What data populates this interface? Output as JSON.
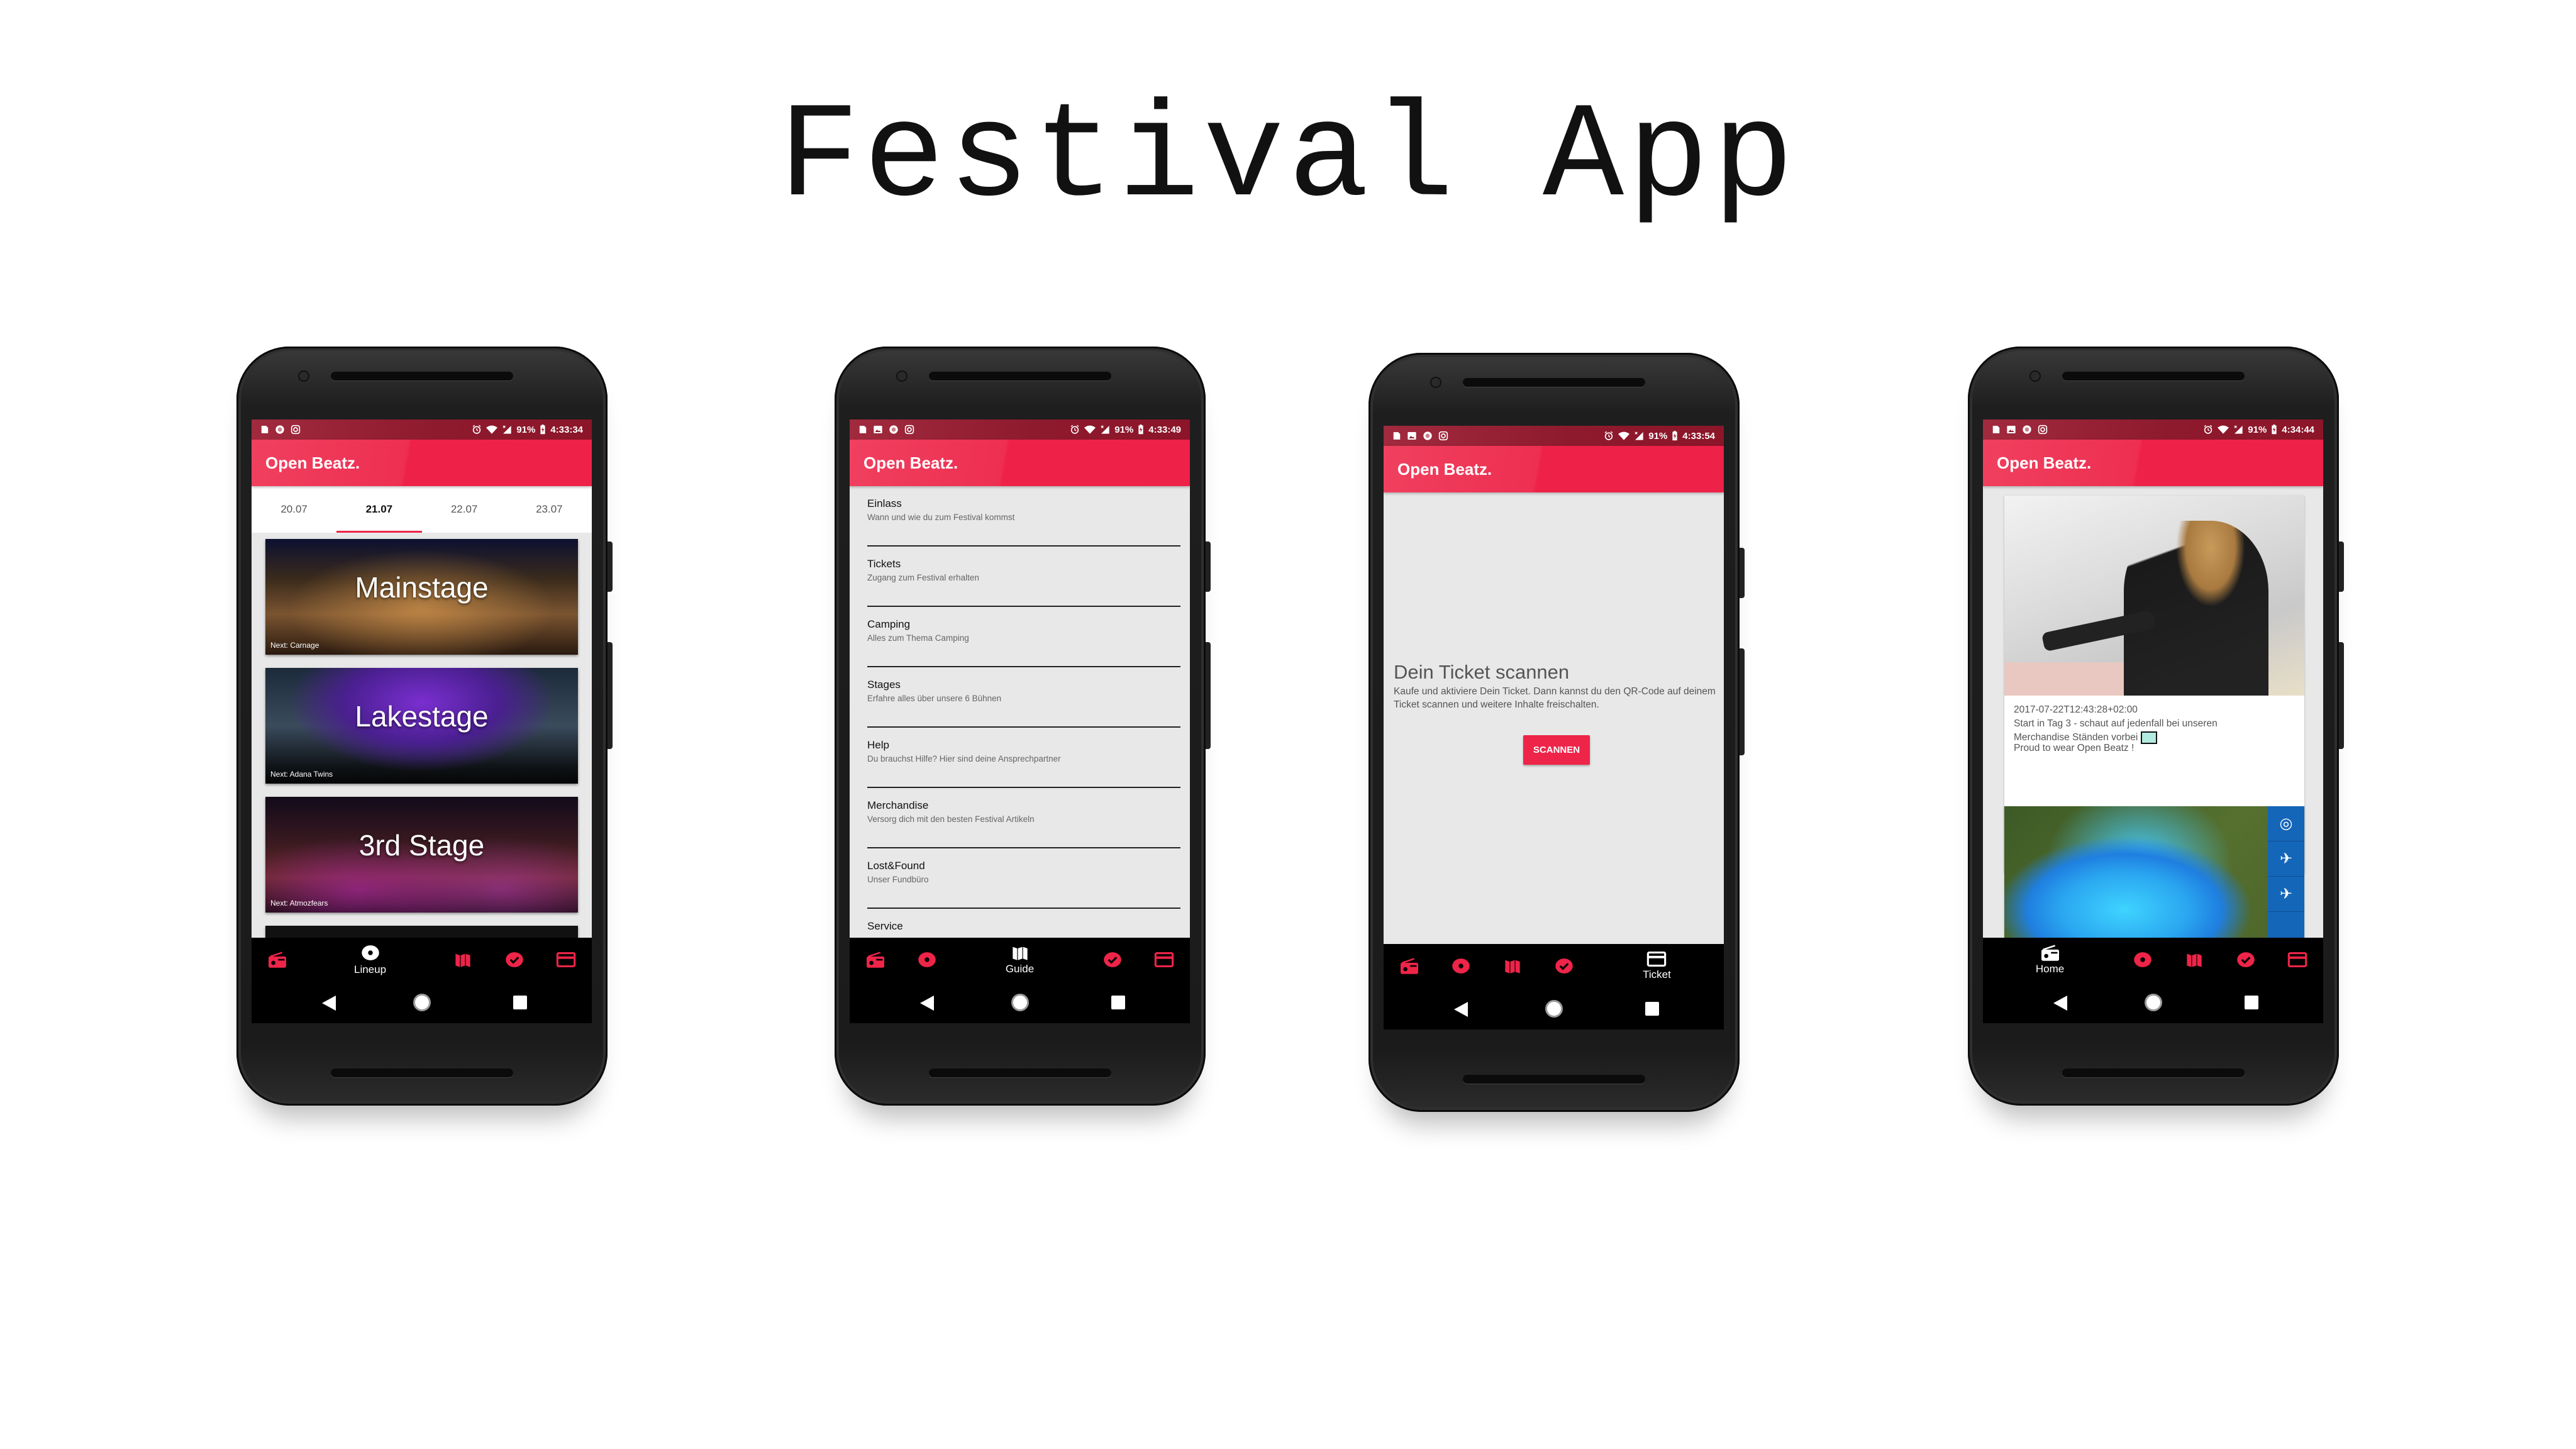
{
  "title": "Festival App",
  "app_name": "Open Beatz.",
  "colors": {
    "accent": "#ee2449",
    "status_bar": "#8e1a2e",
    "content_bg": "#e8e8e8",
    "nav_bg": "#000000"
  },
  "nav": [
    {
      "icon": "radio-icon",
      "label": "Home"
    },
    {
      "icon": "disc-icon",
      "label": "Lineup"
    },
    {
      "icon": "map-icon",
      "label": "Guide"
    },
    {
      "icon": "check-circle-icon",
      "label": ""
    },
    {
      "icon": "card-icon",
      "label": "Ticket"
    }
  ],
  "phones": [
    {
      "screen": "lineup",
      "active_nav": 1,
      "status": {
        "left_icons": [
          "file-icon",
          "record-icon",
          "instagram-icon"
        ],
        "battery": "91%",
        "time": "4:33:34"
      }
    },
    {
      "screen": "guide",
      "active_nav": 2,
      "status": {
        "left_icons": [
          "file-icon",
          "image-icon",
          "record-icon",
          "instagram-icon"
        ],
        "battery": "91%",
        "time": "4:33:49"
      }
    },
    {
      "screen": "ticket",
      "active_nav": 4,
      "status": {
        "left_icons": [
          "file-icon",
          "image-icon",
          "record-icon",
          "instagram-icon"
        ],
        "battery": "91%",
        "time": "4:33:54"
      }
    },
    {
      "screen": "home",
      "active_nav": 0,
      "status": {
        "left_icons": [
          "file-icon",
          "image-icon",
          "record-icon",
          "instagram-icon"
        ],
        "battery": "91%",
        "time": "4:34:44"
      }
    }
  ],
  "lineup": {
    "tabs": [
      "20.07",
      "21.07",
      "22.07",
      "23.07"
    ],
    "active_tab": 1,
    "stages": [
      {
        "name": "Mainstage",
        "next": "Next: Carnage"
      },
      {
        "name": "Lakestage",
        "next": "Next: Adana Twins"
      },
      {
        "name": "3rd Stage",
        "next": "Next: Atmozfears"
      }
    ]
  },
  "guide": {
    "items": [
      {
        "title": "Einlass",
        "subtitle": "Wann und wie du zum Festival kommst"
      },
      {
        "title": "Tickets",
        "subtitle": "Zugang zum Festival erhalten"
      },
      {
        "title": "Camping",
        "subtitle": "Alles zum Thema Camping"
      },
      {
        "title": "Stages",
        "subtitle": "Erfahre alles über unsere 6 Bühnen"
      },
      {
        "title": "Help",
        "subtitle": "Du brauchst Hilfe? Hier sind deine Ansprechpartner"
      },
      {
        "title": "Merchandise",
        "subtitle": "Versorg dich mit den besten Festival Artikeln"
      },
      {
        "title": "Lost&Found",
        "subtitle": "Unser Fundbüro"
      },
      {
        "title": "Service",
        "subtitle": ""
      }
    ]
  },
  "ticket": {
    "heading": "Dein Ticket scannen",
    "body": "Kaufe und aktiviere Dein Ticket. Dann kannst du den QR-Code auf deinem Ticket scannen und weitere Inhalte freischalten.",
    "button": "SCANNEN"
  },
  "home": {
    "post": {
      "date": "2017-07-22T12:43:28+02:00",
      "line1": "Start in Tag 3 - schaut auf jedenfall bei unseren",
      "line2": "Merchandise Ständen vorbei",
      "line3": "Proud to wear Open Beatz !"
    }
  }
}
